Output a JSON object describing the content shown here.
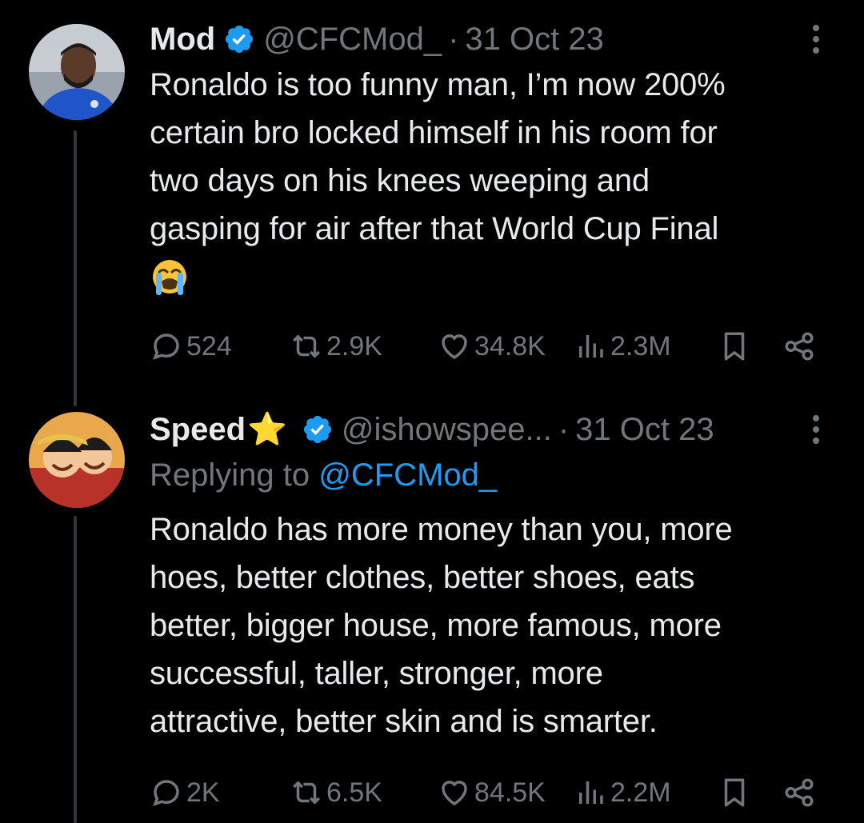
{
  "tweets": [
    {
      "name": "Mod",
      "handle": "@CFCMod_",
      "separator": "·",
      "date": "31 Oct 23",
      "text": "Ronaldo is too funny man, I’m now 200%\ncertain bro locked himself in his room for\ntwo days on his knees weeping and\ngasping for air after that World Cup Final",
      "emoji": "loudly-crying-face",
      "stats": {
        "replies": "524",
        "reposts": "2.9K",
        "likes": "34.8K",
        "views": "2.3M"
      }
    },
    {
      "name": "Speed",
      "name_emoji": "⭐",
      "handle": "@ishowspee...",
      "separator": "·",
      "date": "31 Oct 23",
      "replying_prefix": "Replying to",
      "replying_to": "@CFCMod_",
      "text": "Ronaldo has more money than you, more\nhoes, better clothes, better shoes, eats\nbetter, bigger house, more famous, more\nsuccessful, taller, stronger, more\nattractive, better skin and is smarter.",
      "stats": {
        "replies": "2K",
        "reposts": "6.5K",
        "likes": "84.5K",
        "views": "2.2M"
      }
    }
  ],
  "colors": {
    "background": "#000000",
    "text": "#e7e9ea",
    "muted": "#71767b",
    "accent": "#1d9bf0",
    "verified": "#1d9bf0"
  },
  "icons": [
    "verified-badge-icon",
    "more-options-icon",
    "reply-icon",
    "repost-icon",
    "like-icon",
    "views-icon",
    "bookmark-icon",
    "share-icon"
  ]
}
